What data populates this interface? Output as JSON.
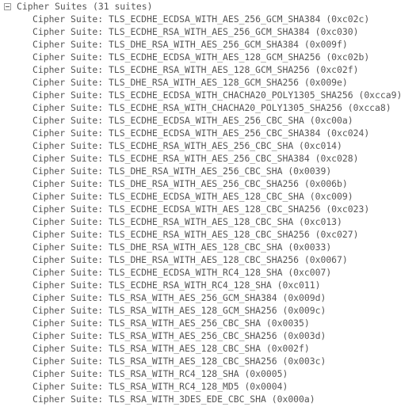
{
  "tree": {
    "header_label": "Cipher Suites (31 suites)",
    "items": [
      "Cipher Suite: TLS_ECDHE_ECDSA_WITH_AES_256_GCM_SHA384 (0xc02c)",
      "Cipher Suite: TLS_ECDHE_RSA_WITH_AES_256_GCM_SHA384 (0xc030)",
      "Cipher Suite: TLS_DHE_RSA_WITH_AES_256_GCM_SHA384 (0x009f)",
      "Cipher Suite: TLS_ECDHE_ECDSA_WITH_AES_128_GCM_SHA256 (0xc02b)",
      "Cipher Suite: TLS_ECDHE_RSA_WITH_AES_128_GCM_SHA256 (0xc02f)",
      "Cipher Suite: TLS_DHE_RSA_WITH_AES_128_GCM_SHA256 (0x009e)",
      "Cipher Suite: TLS_ECDHE_ECDSA_WITH_CHACHA20_POLY1305_SHA256 (0xcca9)",
      "Cipher Suite: TLS_ECDHE_RSA_WITH_CHACHA20_POLY1305_SHA256 (0xcca8)",
      "Cipher Suite: TLS_ECDHE_ECDSA_WITH_AES_256_CBC_SHA (0xc00a)",
      "Cipher Suite: TLS_ECDHE_ECDSA_WITH_AES_256_CBC_SHA384 (0xc024)",
      "Cipher Suite: TLS_ECDHE_RSA_WITH_AES_256_CBC_SHA (0xc014)",
      "Cipher Suite: TLS_ECDHE_RSA_WITH_AES_256_CBC_SHA384 (0xc028)",
      "Cipher Suite: TLS_DHE_RSA_WITH_AES_256_CBC_SHA (0x0039)",
      "Cipher Suite: TLS_DHE_RSA_WITH_AES_256_CBC_SHA256 (0x006b)",
      "Cipher Suite: TLS_ECDHE_ECDSA_WITH_AES_128_CBC_SHA (0xc009)",
      "Cipher Suite: TLS_ECDHE_ECDSA_WITH_AES_128_CBC_SHA256 (0xc023)",
      "Cipher Suite: TLS_ECDHE_RSA_WITH_AES_128_CBC_SHA (0xc013)",
      "Cipher Suite: TLS_ECDHE_RSA_WITH_AES_128_CBC_SHA256 (0xc027)",
      "Cipher Suite: TLS_DHE_RSA_WITH_AES_128_CBC_SHA (0x0033)",
      "Cipher Suite: TLS_DHE_RSA_WITH_AES_128_CBC_SHA256 (0x0067)",
      "Cipher Suite: TLS_ECDHE_ECDSA_WITH_RC4_128_SHA (0xc007)",
      "Cipher Suite: TLS_ECDHE_RSA_WITH_RC4_128_SHA (0xc011)",
      "Cipher Suite: TLS_RSA_WITH_AES_256_GCM_SHA384 (0x009d)",
      "Cipher Suite: TLS_RSA_WITH_AES_128_GCM_SHA256 (0x009c)",
      "Cipher Suite: TLS_RSA_WITH_AES_256_CBC_SHA (0x0035)",
      "Cipher Suite: TLS_RSA_WITH_AES_256_CBC_SHA256 (0x003d)",
      "Cipher Suite: TLS_RSA_WITH_AES_128_CBC_SHA (0x002f)",
      "Cipher Suite: TLS_RSA_WITH_AES_128_CBC_SHA256 (0x003c)",
      "Cipher Suite: TLS_RSA_WITH_RC4_128_SHA (0x0005)",
      "Cipher Suite: TLS_RSA_WITH_RC4_128_MD5 (0x0004)",
      "Cipher Suite: TLS_RSA_WITH_3DES_EDE_CBC_SHA (0x000a)"
    ]
  }
}
